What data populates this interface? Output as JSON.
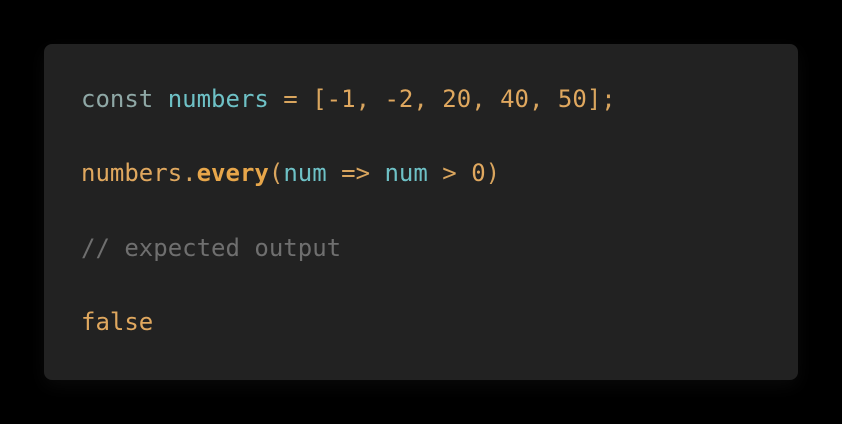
{
  "code": {
    "line1": {
      "keyword": "const",
      "space1": " ",
      "identifier": "numbers",
      "assign": " = ",
      "open_bracket": "[",
      "n1": "-1",
      "sep1": ", ",
      "n2": "-2",
      "sep2": ", ",
      "n3": "20",
      "sep3": ", ",
      "n4": "40",
      "sep4": ", ",
      "n5": "50",
      "close_bracket": "]",
      "semicolon": ";"
    },
    "line2": {
      "object": "numbers",
      "dot": ".",
      "method": "every",
      "open_paren": "(",
      "param": "num",
      "arrow": " => ",
      "param_ref": "num",
      "gt": " > ",
      "zero": "0",
      "close_paren": ")"
    },
    "line3": {
      "comment": "// expected output"
    },
    "line4": {
      "result": "false"
    }
  },
  "colors": {
    "page_background": "#000000",
    "card_background": "#222222",
    "keyword": "#8fa8a6",
    "variable": "#6ec1c6",
    "number": "#e0a85f",
    "method": "#e7a64a",
    "comment": "#6f6f6f"
  }
}
